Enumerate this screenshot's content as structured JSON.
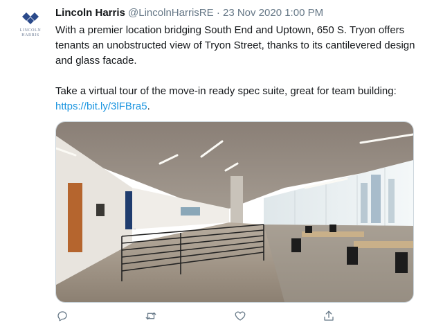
{
  "avatar": {
    "icon": "lincoln-harris-diamond-logo",
    "brand_line1": "LINCOLN",
    "brand_line2": "HARRIS"
  },
  "tweet": {
    "author_name": "Lincoln Harris",
    "handle": "@LincolnHarrisRE",
    "separator": "·",
    "date": "23 Nov 2020 1:00 PM",
    "paragraph1": "With a premier location bridging South End and Uptown, 650 S. Tryon offers tenants an unobstructed view of Tryon Street, thanks to its cantilevered design and glass facade.",
    "paragraph2_text": "Take a virtual tour of the move-in ready spec suite, great for team building: ",
    "link": "https://bit.ly/3lFBra5",
    "paragraph2_end": "."
  },
  "actions": [
    {
      "name": "reply",
      "icon": "reply-icon"
    },
    {
      "name": "retweet",
      "icon": "retweet-icon"
    },
    {
      "name": "like",
      "icon": "heart-icon"
    },
    {
      "name": "share",
      "icon": "share-icon"
    }
  ],
  "colors": {
    "link": "#1b95e0",
    "secondary_text": "#657786",
    "brand_blue": "#2b4a8b"
  }
}
